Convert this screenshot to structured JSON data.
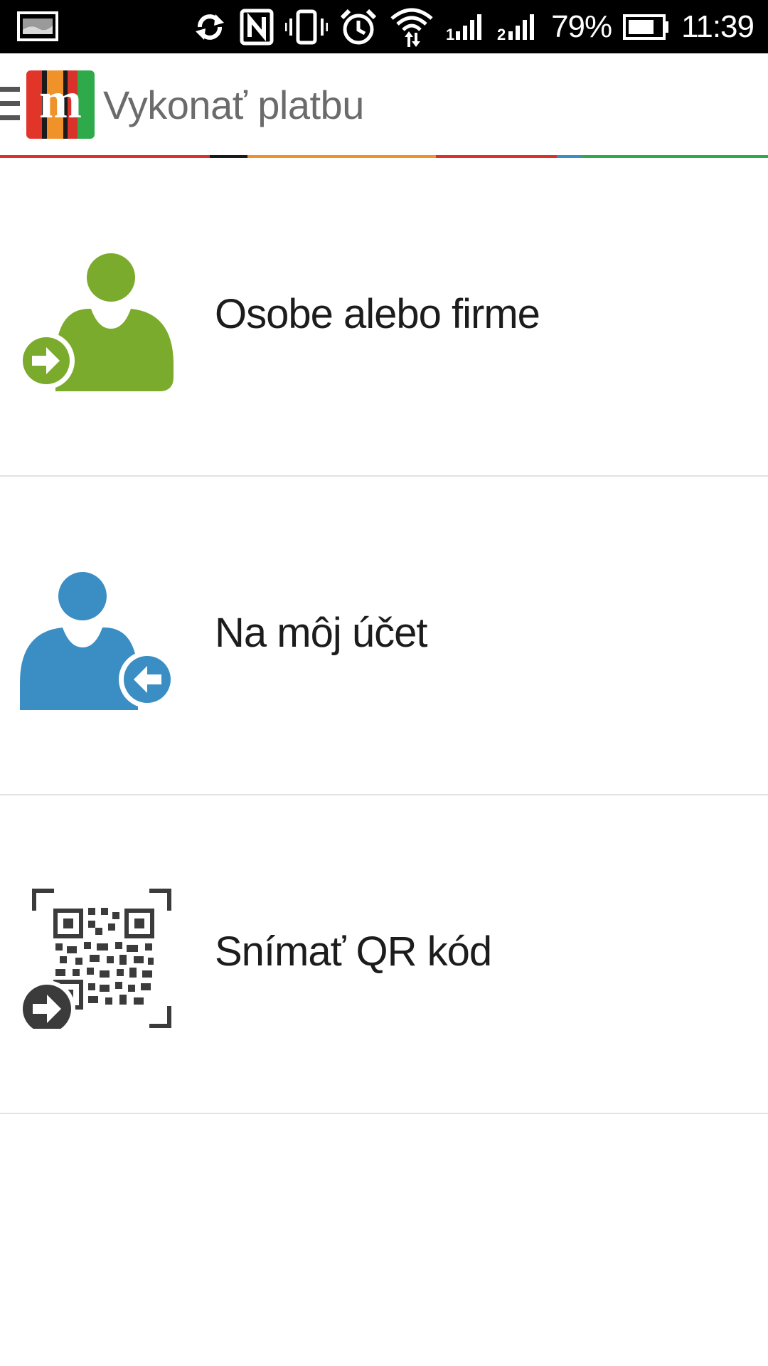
{
  "status_bar": {
    "battery_percent_text": "79%",
    "time": "11:39",
    "icons": [
      "notification-image-icon",
      "sync-icon",
      "nfc-icon",
      "vibrate-icon",
      "alarm-icon",
      "wifi-icon",
      "signal-sim1-icon",
      "signal-sim2-icon",
      "battery-icon"
    ],
    "battery_level": 0.79
  },
  "app_bar": {
    "title": "Vykonať platbu",
    "logo_letter": "m",
    "menu_icon": "hamburger-menu-icon"
  },
  "colors": {
    "green": "#7bab2c",
    "blue": "#3a8ec4",
    "dark": "#3b3b3b",
    "strip": [
      "#d9322a",
      "#1a1a1a",
      "#f0922a",
      "#d9322a",
      "#3a8ec4",
      "#2faa4a"
    ]
  },
  "menu": {
    "items": [
      {
        "label": "Osobe alebo firme",
        "icon": "person-send-icon"
      },
      {
        "label": "Na môj účet",
        "icon": "person-receive-icon"
      },
      {
        "label": "Snímať QR kód",
        "icon": "qr-scan-icon"
      }
    ]
  }
}
